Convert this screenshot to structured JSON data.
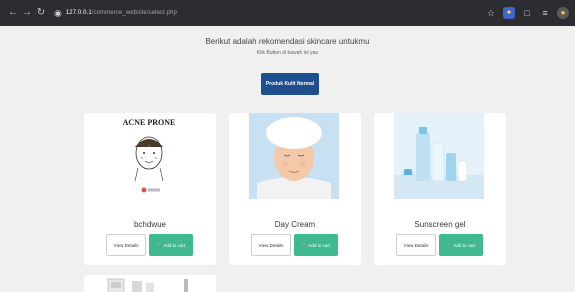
{
  "browser": {
    "url_host": "127.0.0.1",
    "url_path": "/commerce_website/select.php"
  },
  "page": {
    "heading": "Berikut adalah rekomendasi skincare untukmu",
    "subheading": "Klik Button di bawah ini yaa",
    "primary_button": "Produk Kulit Normal"
  },
  "products": [
    {
      "name": "bchdwue",
      "image_caption": "ACNE PRONE",
      "details_label": "View Details",
      "cart_label": "Add to cart"
    },
    {
      "name": "Day Cream",
      "details_label": "View Details",
      "cart_label": "Add to cart"
    },
    {
      "name": "Sunscreen gel",
      "details_label": "View Details",
      "cart_label": "Add to cart"
    }
  ],
  "colors": {
    "browser_bar": "#2b2d31",
    "primary_button": "#1d4f8e",
    "cart_button": "#3fb98f",
    "page_background": "#f0f0f0"
  },
  "icons": {
    "back": "arrow-left-icon",
    "forward": "arrow-right-icon",
    "reload": "reload-icon",
    "site_info": "site-info-icon",
    "bookmark": "star-icon",
    "cart": "cart-icon"
  }
}
